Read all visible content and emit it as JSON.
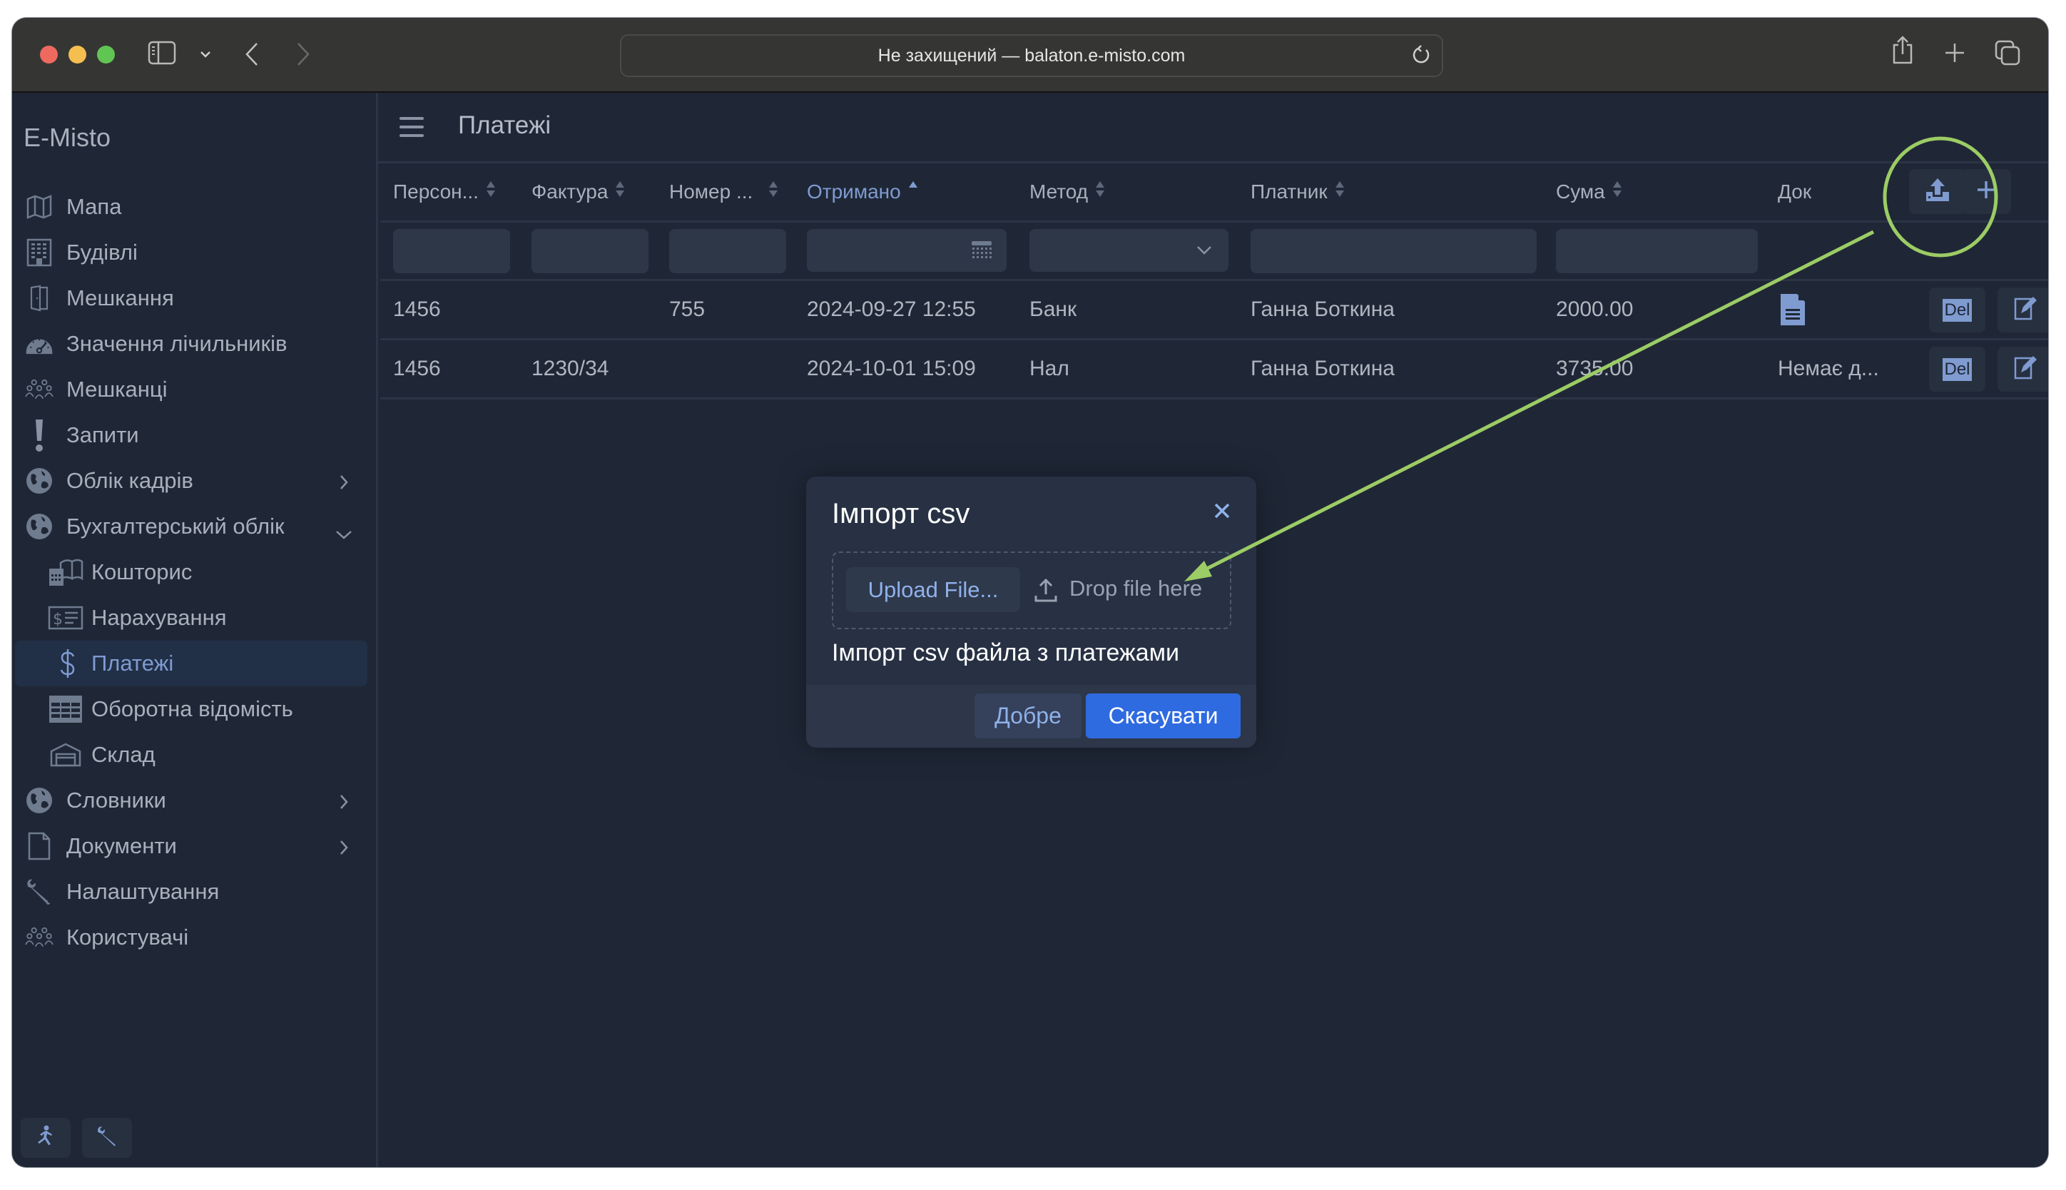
{
  "browser": {
    "url_text": "Не захищений — balaton.e-misto.com",
    "icons": [
      "sidebar-icon",
      "chevron-down-icon",
      "back-icon",
      "forward-icon",
      "reload-icon",
      "share-icon",
      "new-tab-icon",
      "tabs-overview-icon"
    ]
  },
  "sidebar": {
    "brand": "E-Misto",
    "items": [
      {
        "label": "Мапа",
        "icon": "map-icon"
      },
      {
        "label": "Будівлі",
        "icon": "building-icon"
      },
      {
        "label": "Мешкання",
        "icon": "door-icon"
      },
      {
        "label": "Значення лічильників",
        "icon": "gauge-icon"
      },
      {
        "label": "Мешканці",
        "icon": "users-icon"
      },
      {
        "label": "Запити",
        "icon": "exclamation-icon"
      },
      {
        "label": "Облік кадрів",
        "icon": "globe-icon",
        "expandable": true,
        "expanded": false
      },
      {
        "label": "Бухгалтерський облік",
        "icon": "globe-icon",
        "expandable": true,
        "expanded": true
      },
      {
        "label": "Кошторис",
        "icon": "calculator-book-icon",
        "sub": true
      },
      {
        "label": "Нарахування",
        "icon": "invoice-icon",
        "sub": true
      },
      {
        "label": "Платежі",
        "icon": "dollar-icon",
        "sub": true,
        "active": true
      },
      {
        "label": "Оборотна відомість",
        "icon": "table-icon",
        "sub": true
      },
      {
        "label": "Склад",
        "icon": "warehouse-icon",
        "sub": true
      },
      {
        "label": "Словники",
        "icon": "globe-icon",
        "expandable": true,
        "expanded": false
      },
      {
        "label": "Документи",
        "icon": "document-icon",
        "expandable": true,
        "expanded": false
      },
      {
        "label": "Налаштування",
        "icon": "wrench-icon"
      },
      {
        "label": "Користувачі",
        "icon": "users-icon"
      }
    ],
    "bottom_buttons": [
      "logout-run-icon",
      "wrench-icon"
    ]
  },
  "page": {
    "title": "Платежі"
  },
  "table": {
    "columns": [
      {
        "label": "Персон...",
        "sortable": true,
        "filter": "text"
      },
      {
        "label": "Фактура",
        "sortable": true,
        "filter": "text"
      },
      {
        "label": "Номер ...",
        "sortable": true,
        "filter": "text"
      },
      {
        "label": "Отримано",
        "sortable": true,
        "sorted": "asc",
        "filter": "date"
      },
      {
        "label": "Метод",
        "sortable": true,
        "filter": "select"
      },
      {
        "label": "Платник",
        "sortable": true,
        "filter": "text"
      },
      {
        "label": "Сума",
        "sortable": true,
        "filter": "text"
      },
      {
        "label": "Док",
        "sortable": false
      }
    ],
    "filters": [
      "",
      "",
      "",
      "",
      "",
      "",
      ""
    ],
    "rows": [
      {
        "personal": "1456",
        "invoice": "",
        "number": "755",
        "received": "2024-09-27 12:55",
        "method": "Банк",
        "payer": "Ганна Боткина",
        "amount": "2000.00",
        "doc": "document-icon"
      },
      {
        "personal": "1456",
        "invoice": "1230/34",
        "number": "",
        "received": "2024-10-01 15:09",
        "method": "Нал",
        "payer": "Ганна Боткина",
        "amount": "3735.00",
        "doc": "Немає д..."
      }
    ],
    "row_actions": [
      "Del",
      "edit-icon"
    ],
    "header_actions": [
      "upload-icon",
      "plus-icon"
    ]
  },
  "modal": {
    "title": "Імпорт csv",
    "upload_button": "Upload File...",
    "drop_text": "Drop file here",
    "description": "Імпорт csv файла з платежами",
    "ok_button": "Добре",
    "cancel_button": "Скасувати"
  },
  "annotation": {
    "color": "#9ccc65",
    "shape": "circle around upload button with arrow pointing to drop zone"
  }
}
